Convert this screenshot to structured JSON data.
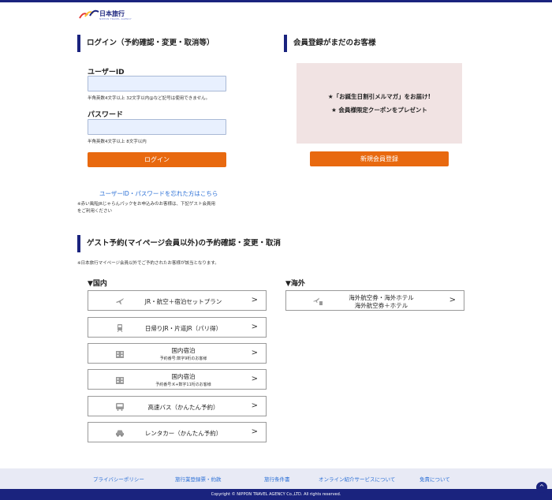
{
  "header": {
    "logo_text": "日本旅行",
    "logo_sub": "NIPPON TRAVEL AGENCY"
  },
  "login": {
    "title": "ログイン（予約確認・変更・取消等）",
    "user_label": "ユーザーID",
    "user_value": "",
    "user_hint": "半角英数4文字以上 32文字以内@など記号は使用できません。",
    "pass_label": "パスワード",
    "pass_value": "",
    "pass_hint": "半角英数4文字以上 8文字以内",
    "login_button": "ログイン",
    "forgot_link": "ユーザーID・パスワードを忘れた方はこちら",
    "note_line1": "※赤い風船JRじゃらんパックをお申込みのお客様は、下記ゲスト会員用",
    "note_line2": "をご利用ください"
  },
  "register": {
    "title": "会員登録がまだのお客様",
    "promo_line1": "★「お誕生日割引メルマガ」をお届け!",
    "promo_line2": "★ 会員様限定クーポンをプレゼント",
    "register_button": "新規会員登録"
  },
  "guest": {
    "title": "ゲスト予約(マイページ会員以外)の予約確認・変更・取消",
    "note": "※日本旅行マイページ会員以外でご予約されたお客様が該当となります。",
    "domestic_head": "▼国内",
    "overseas_head": "▼海外",
    "arrow": ">",
    "domestic": [
      {
        "label": "JR・航空＋宿泊セットプラン",
        "sub": "",
        "icon": "plane-train-icon"
      },
      {
        "label": "日帰りJR・片道JR（パリ得）",
        "sub": "",
        "icon": "train-icon"
      },
      {
        "label": "国内宿泊",
        "sub": "予約番号:数字9桁のお客様",
        "icon": "hotel-icon"
      },
      {
        "label": "国内宿泊",
        "sub": "予約番号:K+数字11桁のお客様",
        "icon": "hotel-icon"
      },
      {
        "label": "高速バス（かんたん予約）",
        "sub": "",
        "icon": "bus-icon"
      },
      {
        "label": "レンタカー（かんたん予約）",
        "sub": "",
        "icon": "car-icon"
      }
    ],
    "overseas": [
      {
        "label_line1": "海外航空券・海外ホテル",
        "label_line2": "海外航空券＋ホテル",
        "icon": "plane-hotel-icon"
      }
    ]
  },
  "footer": {
    "links": [
      "プライバシーポリシー",
      "旅行業登録票・約款",
      "旅行条件書",
      "オンライン紹介サービスについて",
      "免責について"
    ],
    "copyright": "Copyright © NIPPON TRAVEL AGENCY Co.,LTD. All rights reserved.",
    "totop": "^"
  },
  "colors": {
    "brand_navy": "#1a237e",
    "accent_orange": "#e8690f",
    "link_blue": "#2a6fd6",
    "input_bg": "#e8f0fe",
    "promo_bg": "#f1e3e3"
  }
}
